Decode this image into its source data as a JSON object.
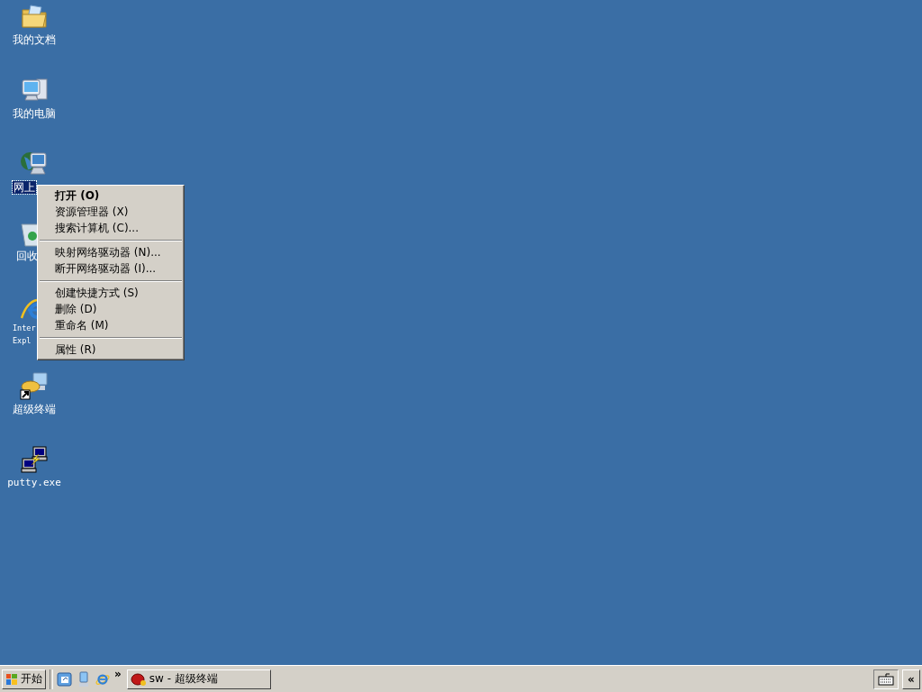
{
  "desktop_icons": [
    {
      "kind": "folder",
      "selected": false,
      "lines": [
        "我的文档"
      ]
    },
    {
      "kind": "computer",
      "selected": false,
      "lines": [
        "我的电脑"
      ]
    },
    {
      "kind": "network",
      "selected": true,
      "lines": [
        "网上"
      ]
    },
    {
      "kind": "recycle",
      "selected": false,
      "lines": [
        "回收"
      ]
    },
    {
      "kind": "browser",
      "selected": false,
      "lines": [
        "Inter",
        "Expl"
      ]
    },
    {
      "kind": "terminal",
      "selected": false,
      "lines": [
        "超级终端"
      ]
    },
    {
      "kind": "putty",
      "selected": false,
      "lines": [
        "putty.exe"
      ]
    }
  ],
  "context_menu": [
    {
      "kind": "item",
      "label": "打开 (O)",
      "default": true
    },
    {
      "kind": "item",
      "label": "资源管理器 (X)",
      "default": false
    },
    {
      "kind": "item",
      "label": "搜索计算机 (C)...",
      "default": false
    },
    {
      "kind": "separator"
    },
    {
      "kind": "item",
      "label": "映射网络驱动器 (N)...",
      "default": false
    },
    {
      "kind": "item",
      "label": "断开网络驱动器 (I)...",
      "default": false
    },
    {
      "kind": "separator"
    },
    {
      "kind": "item",
      "label": "创建快捷方式 (S)",
      "default": false
    },
    {
      "kind": "item",
      "label": "删除 (D)",
      "default": false
    },
    {
      "kind": "item",
      "label": "重命名 (M)",
      "default": false
    },
    {
      "kind": "separator"
    },
    {
      "kind": "item",
      "label": "属性 (R)",
      "default": false
    }
  ],
  "taskbar": {
    "start_label": "开始",
    "quick_launch": [
      {
        "kind": "desktop"
      },
      {
        "kind": "network"
      },
      {
        "kind": "browser"
      }
    ],
    "more": "»",
    "tasks": [
      {
        "label": "sw - 超级终端",
        "selected": false
      }
    ],
    "tray_toggle": "«"
  }
}
